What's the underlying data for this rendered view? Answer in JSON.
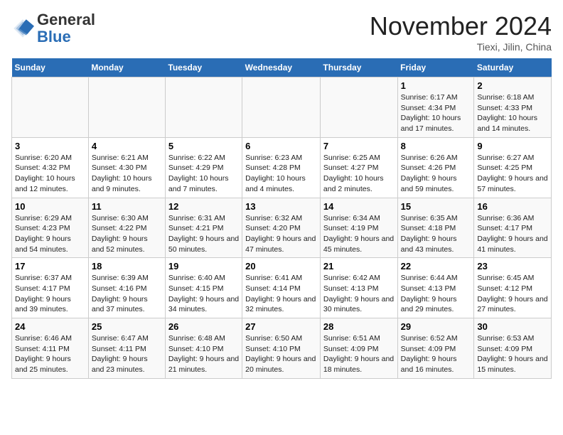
{
  "logo": {
    "general": "General",
    "blue": "Blue"
  },
  "title": "November 2024",
  "location": "Tiexi, Jilin, China",
  "days_of_week": [
    "Sunday",
    "Monday",
    "Tuesday",
    "Wednesday",
    "Thursday",
    "Friday",
    "Saturday"
  ],
  "weeks": [
    [
      {
        "day": "",
        "info": ""
      },
      {
        "day": "",
        "info": ""
      },
      {
        "day": "",
        "info": ""
      },
      {
        "day": "",
        "info": ""
      },
      {
        "day": "",
        "info": ""
      },
      {
        "day": "1",
        "info": "Sunrise: 6:17 AM\nSunset: 4:34 PM\nDaylight: 10 hours and 17 minutes."
      },
      {
        "day": "2",
        "info": "Sunrise: 6:18 AM\nSunset: 4:33 PM\nDaylight: 10 hours and 14 minutes."
      }
    ],
    [
      {
        "day": "3",
        "info": "Sunrise: 6:20 AM\nSunset: 4:32 PM\nDaylight: 10 hours and 12 minutes."
      },
      {
        "day": "4",
        "info": "Sunrise: 6:21 AM\nSunset: 4:30 PM\nDaylight: 10 hours and 9 minutes."
      },
      {
        "day": "5",
        "info": "Sunrise: 6:22 AM\nSunset: 4:29 PM\nDaylight: 10 hours and 7 minutes."
      },
      {
        "day": "6",
        "info": "Sunrise: 6:23 AM\nSunset: 4:28 PM\nDaylight: 10 hours and 4 minutes."
      },
      {
        "day": "7",
        "info": "Sunrise: 6:25 AM\nSunset: 4:27 PM\nDaylight: 10 hours and 2 minutes."
      },
      {
        "day": "8",
        "info": "Sunrise: 6:26 AM\nSunset: 4:26 PM\nDaylight: 9 hours and 59 minutes."
      },
      {
        "day": "9",
        "info": "Sunrise: 6:27 AM\nSunset: 4:25 PM\nDaylight: 9 hours and 57 minutes."
      }
    ],
    [
      {
        "day": "10",
        "info": "Sunrise: 6:29 AM\nSunset: 4:23 PM\nDaylight: 9 hours and 54 minutes."
      },
      {
        "day": "11",
        "info": "Sunrise: 6:30 AM\nSunset: 4:22 PM\nDaylight: 9 hours and 52 minutes."
      },
      {
        "day": "12",
        "info": "Sunrise: 6:31 AM\nSunset: 4:21 PM\nDaylight: 9 hours and 50 minutes."
      },
      {
        "day": "13",
        "info": "Sunrise: 6:32 AM\nSunset: 4:20 PM\nDaylight: 9 hours and 47 minutes."
      },
      {
        "day": "14",
        "info": "Sunrise: 6:34 AM\nSunset: 4:19 PM\nDaylight: 9 hours and 45 minutes."
      },
      {
        "day": "15",
        "info": "Sunrise: 6:35 AM\nSunset: 4:18 PM\nDaylight: 9 hours and 43 minutes."
      },
      {
        "day": "16",
        "info": "Sunrise: 6:36 AM\nSunset: 4:17 PM\nDaylight: 9 hours and 41 minutes."
      }
    ],
    [
      {
        "day": "17",
        "info": "Sunrise: 6:37 AM\nSunset: 4:17 PM\nDaylight: 9 hours and 39 minutes."
      },
      {
        "day": "18",
        "info": "Sunrise: 6:39 AM\nSunset: 4:16 PM\nDaylight: 9 hours and 37 minutes."
      },
      {
        "day": "19",
        "info": "Sunrise: 6:40 AM\nSunset: 4:15 PM\nDaylight: 9 hours and 34 minutes."
      },
      {
        "day": "20",
        "info": "Sunrise: 6:41 AM\nSunset: 4:14 PM\nDaylight: 9 hours and 32 minutes."
      },
      {
        "day": "21",
        "info": "Sunrise: 6:42 AM\nSunset: 4:13 PM\nDaylight: 9 hours and 30 minutes."
      },
      {
        "day": "22",
        "info": "Sunrise: 6:44 AM\nSunset: 4:13 PM\nDaylight: 9 hours and 29 minutes."
      },
      {
        "day": "23",
        "info": "Sunrise: 6:45 AM\nSunset: 4:12 PM\nDaylight: 9 hours and 27 minutes."
      }
    ],
    [
      {
        "day": "24",
        "info": "Sunrise: 6:46 AM\nSunset: 4:11 PM\nDaylight: 9 hours and 25 minutes."
      },
      {
        "day": "25",
        "info": "Sunrise: 6:47 AM\nSunset: 4:11 PM\nDaylight: 9 hours and 23 minutes."
      },
      {
        "day": "26",
        "info": "Sunrise: 6:48 AM\nSunset: 4:10 PM\nDaylight: 9 hours and 21 minutes."
      },
      {
        "day": "27",
        "info": "Sunrise: 6:50 AM\nSunset: 4:10 PM\nDaylight: 9 hours and 20 minutes."
      },
      {
        "day": "28",
        "info": "Sunrise: 6:51 AM\nSunset: 4:09 PM\nDaylight: 9 hours and 18 minutes."
      },
      {
        "day": "29",
        "info": "Sunrise: 6:52 AM\nSunset: 4:09 PM\nDaylight: 9 hours and 16 minutes."
      },
      {
        "day": "30",
        "info": "Sunrise: 6:53 AM\nSunset: 4:09 PM\nDaylight: 9 hours and 15 minutes."
      }
    ]
  ]
}
